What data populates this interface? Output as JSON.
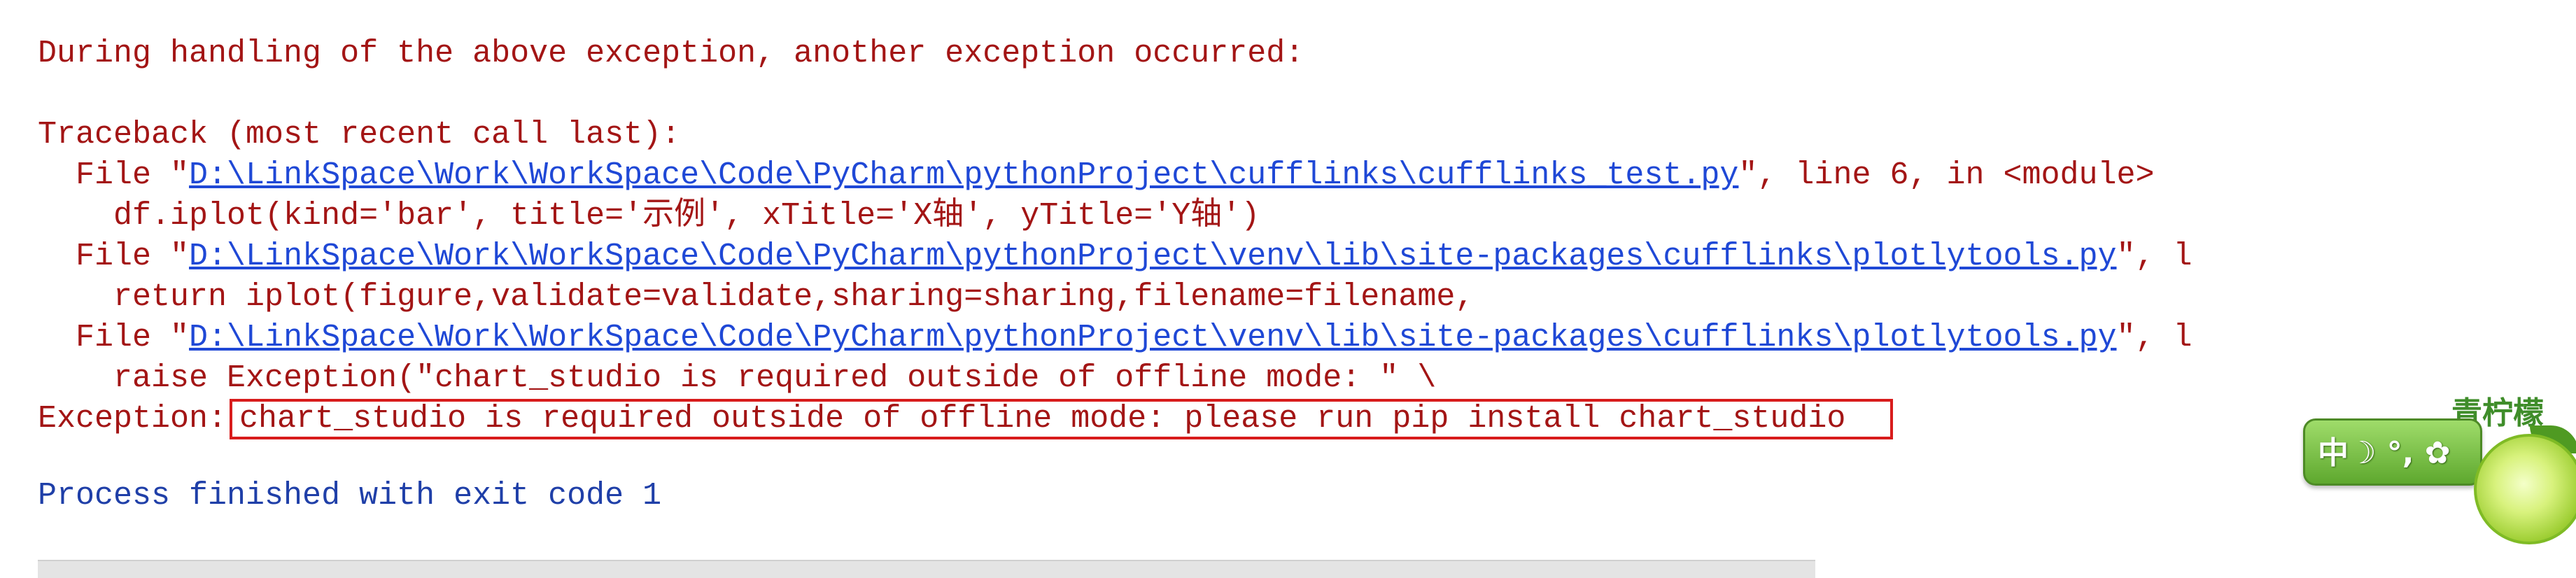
{
  "console": {
    "line_during": "During handling of the above exception, another exception occurred:",
    "traceback_header": "Traceback (most recent call last):",
    "frames": [
      {
        "prefix": "  File \"",
        "path": "D:\\LinkSpace\\Work\\WorkSpace\\Code\\PyCharm\\pythonProject\\cufflinks\\cufflinks_test.py",
        "suffix": "\", line 6, in <module>",
        "code": "    df.iplot(kind='bar', title='示例', xTitle='X轴', yTitle='Y轴')"
      },
      {
        "prefix": "  File \"",
        "path": "D:\\LinkSpace\\Work\\WorkSpace\\Code\\PyCharm\\pythonProject\\venv\\lib\\site-packages\\cufflinks\\plotlytools.py",
        "suffix": "\", l",
        "code": "    return iplot(figure,validate=validate,sharing=sharing,filename=filename,"
      },
      {
        "prefix": "  File \"",
        "path": "D:\\LinkSpace\\Work\\WorkSpace\\Code\\PyCharm\\pythonProject\\venv\\lib\\site-packages\\cufflinks\\plotlytools.py",
        "suffix": "\", l",
        "code": "    raise Exception(\"chart_studio is required outside of offline mode: \" \\"
      }
    ],
    "exception_label": "Exception:",
    "exception_message": "chart_studio is required outside of offline mode: please run pip install chart_studio",
    "process_finished": "Process finished with exit code 1"
  },
  "ime_widget": {
    "brand": "青柠檬",
    "status": "中☽ °, ✿"
  },
  "colors": {
    "error_text": "#a31515",
    "link": "#1f48d6",
    "info_text": "#1f3fa8",
    "highlight_box": "#d81c1c",
    "ime_green": "#5ea82e"
  }
}
